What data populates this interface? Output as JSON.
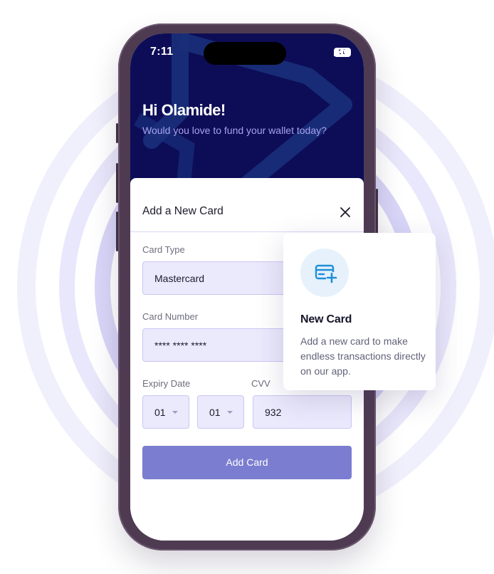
{
  "status": {
    "time": "7:11",
    "battery": "50"
  },
  "header": {
    "greeting": "Hi Olamide!",
    "subtitle": "Would you love to fund your wallet today?"
  },
  "sheet": {
    "title": "Add a New Card",
    "card_type": {
      "label": "Card Type",
      "value": "Mastercard"
    },
    "card_number": {
      "label": "Card Number",
      "value": "**** **** ****"
    },
    "expiry": {
      "label": "Expiry Date",
      "month": "01",
      "year": "01"
    },
    "cvv": {
      "label": "CVV",
      "value": "932"
    },
    "submit_label": "Add Card"
  },
  "popup": {
    "title": "New Card",
    "description": "Add a new card to make endless transactions directly on our app."
  },
  "colors": {
    "header_bg": "#0d0d57",
    "accent": "#7b7dd0",
    "field_bg": "#ebe9fc",
    "ring": "#c9c6f4"
  },
  "icons": [
    "signal-icon",
    "wifi-icon",
    "battery-icon",
    "close-icon",
    "add-card-icon",
    "chevron-down-icon"
  ]
}
